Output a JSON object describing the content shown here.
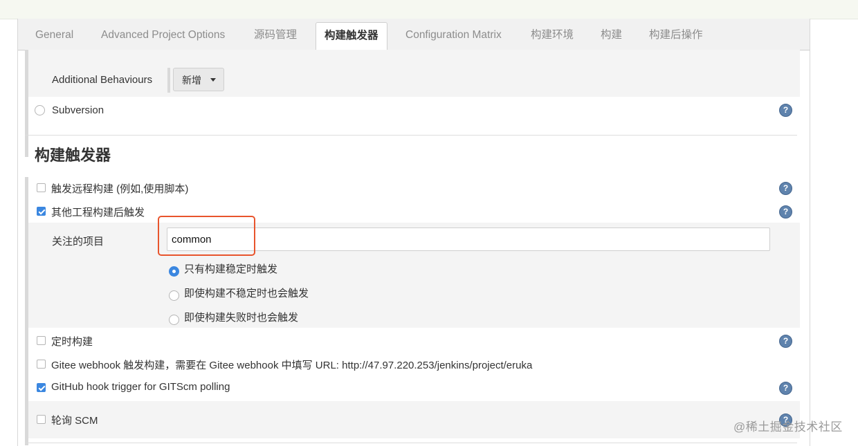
{
  "tabs": [
    {
      "label": "General"
    },
    {
      "label": "Advanced Project Options"
    },
    {
      "label": "源码管理"
    },
    {
      "label": "构建触发器"
    },
    {
      "label": "Configuration Matrix"
    },
    {
      "label": "构建环境"
    },
    {
      "label": "构建"
    },
    {
      "label": "构建后操作"
    }
  ],
  "scm": {
    "additional_behaviours_label": "Additional Behaviours",
    "add_button_label": "新增",
    "subversion_label": "Subversion"
  },
  "triggers": {
    "heading": "构建触发器",
    "remote_build_label": "触发远程构建 (例如,使用脚本)",
    "after_other_projects_label": "其他工程构建后触发",
    "watched_projects_label": "关注的项目",
    "watched_projects_value": "common",
    "radio_options": [
      {
        "label": "只有构建稳定时触发",
        "selected": true
      },
      {
        "label": "即使构建不稳定时也会触发",
        "selected": false
      },
      {
        "label": "即使构建失败时也会触发",
        "selected": false
      }
    ],
    "scheduled_build_label": "定时构建",
    "gitee_webhook_label": "Gitee webhook 触发构建，需要在 Gitee webhook 中填写 URL: http://47.97.220.253/jenkins/project/eruka",
    "github_hook_label": "GitHub hook trigger for GITScm polling",
    "poll_scm_label": "轮询 SCM"
  },
  "help_glyph": "?",
  "watermark": "@稀土掘金技术社区",
  "colors": {
    "accent": "#3b87e0",
    "highlight": "#e8542c",
    "help": "#5f83ad"
  }
}
